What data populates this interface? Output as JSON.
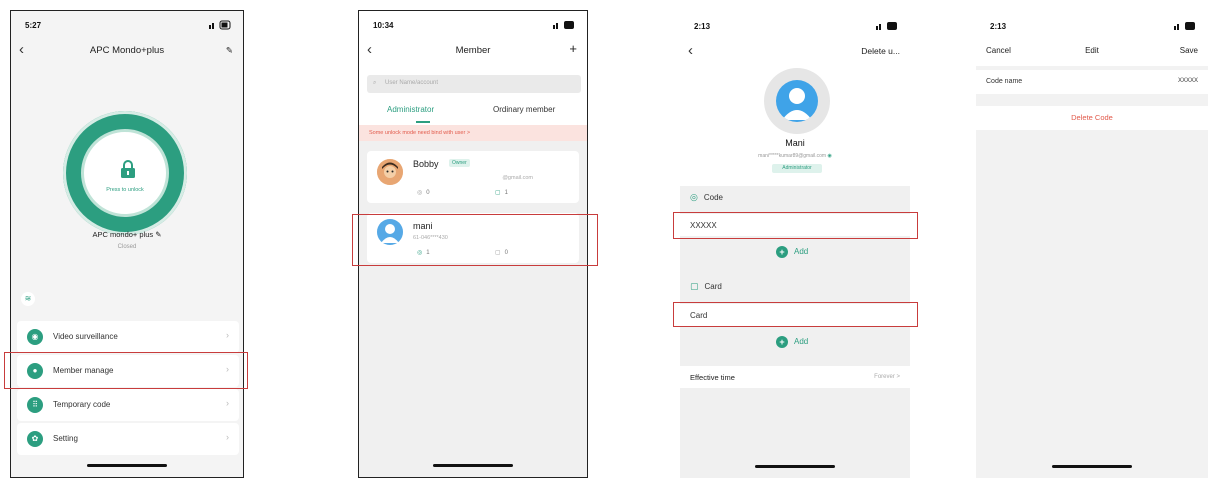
{
  "accent": "#2c9e80",
  "highlight_color": "#c83c3c",
  "phone1": {
    "time": "5:27",
    "title": "APC Mondo+plus",
    "back_icon": "chevron-left-icon",
    "edit_icon": "pencil-icon",
    "lock_label": "Press to unlock",
    "device_name": "APC mondo+ plus",
    "device_state": "Closed",
    "menu": [
      {
        "label": "Video surveillance",
        "icon": "camera-icon"
      },
      {
        "label": "Member manage",
        "icon": "person-icon"
      },
      {
        "label": "Temporary code",
        "icon": "keypad-icon"
      },
      {
        "label": "Setting",
        "icon": "gear-icon"
      }
    ]
  },
  "phone2": {
    "time": "10:34",
    "title": "Member",
    "add_icon": "plus-icon",
    "search_placeholder": "User Name/account",
    "tabs": [
      "Administrator",
      "Ordinary member"
    ],
    "warning": "Some unlock mode need bind with user >",
    "members": [
      {
        "name": "Bobby",
        "badge": "Owner",
        "sub": "@gmail.com",
        "codes": "0",
        "cards": "1"
      },
      {
        "name": "mani",
        "badge": "",
        "sub": "61-046****430",
        "codes": "1",
        "cards": "0"
      }
    ]
  },
  "phone3": {
    "time": "2:13",
    "right_action": "Delete u...",
    "name": "Mani",
    "email": "mani*****kumar89@gmail.com",
    "role": "Administrator",
    "code_section": "Code",
    "code_value": "XXXXX",
    "add_label": "Add",
    "card_section": "Card",
    "card_value": "Card",
    "effective_label": "Effective time",
    "effective_value": "Forever >"
  },
  "phone4": {
    "time": "2:13",
    "cancel": "Cancel",
    "title": "Edit",
    "save": "Save",
    "row_label": "Code name",
    "row_value": "XXXXX",
    "delete": "Delete Code"
  }
}
